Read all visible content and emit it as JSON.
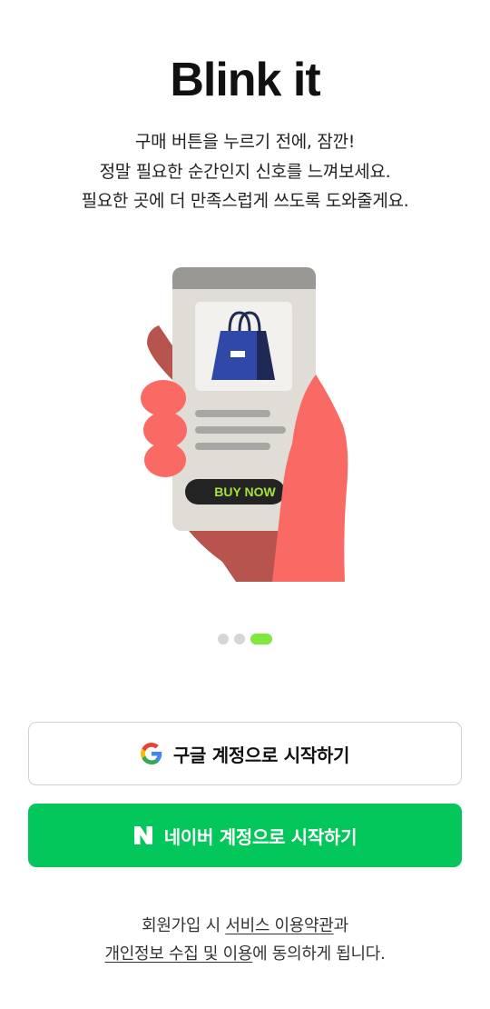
{
  "app": {
    "title": "Blink it"
  },
  "intro": {
    "lines": [
      "구매 버튼을 누르기 전에, 잠깐!",
      "정말 필요한 순간인지 신호를 느껴보세요.",
      "필요한 곳에 더 만족스럽게 쓰도록 도와줄게요."
    ]
  },
  "illustration": {
    "button_text": "BUY NOW"
  },
  "carousel": {
    "total": 3,
    "active_index": 2,
    "active_color": "#7ee83f",
    "inactive_color": "#d6d6d6"
  },
  "login": {
    "google_label": "구글 계정으로 시작하기",
    "naver_label": "네이버 계정으로 시작하기",
    "naver_color": "#03c75a",
    "google_icon": "google-g-icon",
    "naver_icon": "naver-n-icon"
  },
  "footer": {
    "line1_prefix": "회원가입 시 ",
    "terms_link": "서비스 이용약관",
    "line1_suffix": "과",
    "privacy_link": "개인정보 수집 및 이용",
    "line2_suffix": "에 동의하게 됩니다."
  }
}
